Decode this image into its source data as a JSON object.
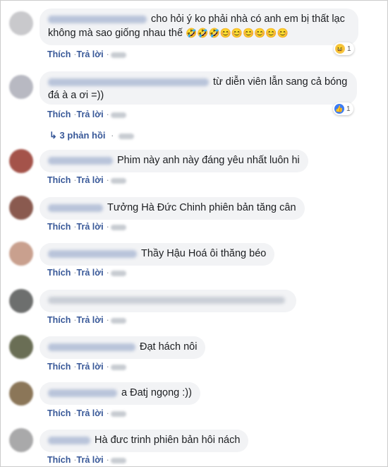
{
  "labels": {
    "like": "Thích",
    "reply": "Trả lời",
    "dot": "·"
  },
  "comments": [
    {
      "text_1": "cho hỏi ý ko phải nhà có anh em bị thất lạc",
      "text_2": "không mà sao giống nhau thế",
      "emojis": "🤣🤣🤣😊😊😊😊😊😊",
      "reaction_count": "1",
      "reaction_icon": "haha-icon"
    },
    {
      "text_1": "từ diễn viên lẫn sang cả bóng",
      "text_2": "đá à a ơi =))",
      "reaction_count": "1",
      "reaction_icon": "like-icon",
      "replies_label": "3 phản hồi"
    },
    {
      "text": "Phim này anh này đáng yêu nhất luôn hi"
    },
    {
      "text": "Tưởng Hà Đức Chinh phiên bản tăng cân"
    },
    {
      "text": "Thầy Hậu Hoá ôi thăng béo"
    },
    {
      "text": ""
    },
    {
      "text": "Đạt hách nôi"
    },
    {
      "text": "a Đatj ngọng :))"
    },
    {
      "text": "Hà đưc trinh phiên bản hôi nách"
    }
  ],
  "avatar_colors": [
    "#c9c9cc",
    "#b8b9c2",
    "#a4534a",
    "#8a5a4f",
    "#c9a08e",
    "#6d6f6e",
    "#6a6e55",
    "#8b7658",
    "#a9a9aa"
  ]
}
